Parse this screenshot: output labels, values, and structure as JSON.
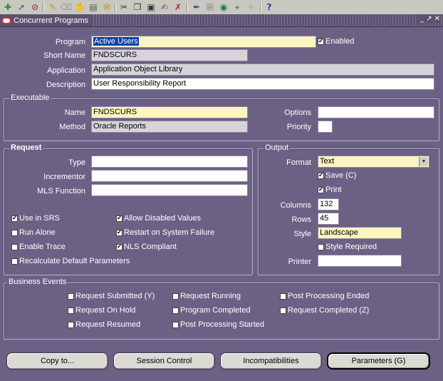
{
  "toolbar": {
    "icons": [
      "new-icon",
      "open-icon",
      "save-icon",
      "tb-sep",
      "print-icon",
      "clear-icon",
      "find-icon",
      "notes-icon",
      "tb-sep",
      "cut-icon",
      "copy-icon",
      "paste-icon",
      "edit-icon",
      "delete-icon",
      "tb-sep",
      "spell-icon",
      "attachments-icon",
      "globe-icon",
      "folder-icon",
      "translate-icon",
      "tb-sep",
      "help-icon"
    ],
    "help_glyph": "?"
  },
  "window": {
    "title": "Concurrent Programs",
    "controls": [
      "_",
      "↗",
      "✕"
    ]
  },
  "header": {
    "program_label": "Program",
    "program_value": "Active Users",
    "enabled_label": "Enabled",
    "enabled_checked": true,
    "short_name_label": "Short Name",
    "short_name_value": "FNDSCURS",
    "application_label": "Application",
    "application_value": "Application Object Library",
    "description_label": "Description",
    "description_value": "User Responsibility Report"
  },
  "executable": {
    "title": "Executable",
    "name_label": "Name",
    "name_value": "FNDSCURS",
    "method_label": "Method",
    "method_value": "Oracle Reports",
    "options_label": "Options",
    "options_value": "",
    "priority_label": "Priority",
    "priority_value": ""
  },
  "request": {
    "title": "Request",
    "type_label": "Type",
    "type_value": "",
    "incrementor_label": "Incrementor",
    "incrementor_value": "",
    "mls_label": "MLS Function",
    "mls_value": "",
    "checks": {
      "use_in_srs": {
        "label": "Use in SRS",
        "checked": true
      },
      "allow_disabled": {
        "label": "Allow Disabled Values",
        "checked": true
      },
      "run_alone": {
        "label": "Run Alone",
        "checked": false
      },
      "restart": {
        "label": "Restart on System Failure",
        "checked": true
      },
      "enable_trace": {
        "label": "Enable Trace",
        "checked": false
      },
      "nls": {
        "label": "NLS Compliant",
        "checked": true
      },
      "recalc": {
        "label": "Recalculate Default Parameters",
        "checked": false
      }
    }
  },
  "output": {
    "title": "Output",
    "format_label": "Format",
    "format_value": "Text",
    "save_label": "Save (C)",
    "save_checked": true,
    "print_label": "Print",
    "print_checked": true,
    "columns_label": "Columns",
    "columns_value": "132",
    "rows_label": "Rows",
    "rows_value": "45",
    "style_label": "Style",
    "style_value": "Landscape",
    "style_required_label": "Style Required",
    "style_required_checked": false,
    "printer_label": "Printer",
    "printer_value": ""
  },
  "business_events": {
    "title": "Business Events",
    "items": [
      {
        "label": "Request Submitted (Y)",
        "checked": false
      },
      {
        "label": "Request Running",
        "checked": false
      },
      {
        "label": "Post Processing Ended",
        "checked": false
      },
      {
        "label": "Request On Hold",
        "checked": false
      },
      {
        "label": "Program Completed",
        "checked": false
      },
      {
        "label": "Request Completed (Z)",
        "checked": false
      },
      {
        "label": "Request Resumed",
        "checked": false
      },
      {
        "label": "Post Processing Started",
        "checked": false
      }
    ]
  },
  "buttons": {
    "copy_to": "Copy to...",
    "session_control": "Session Control",
    "incompatibilities": "Incompatibilities",
    "parameters": "Parameters (G)"
  },
  "check_glyph": "✔"
}
